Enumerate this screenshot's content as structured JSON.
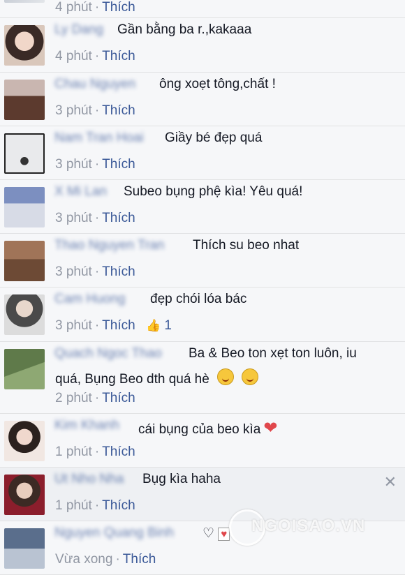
{
  "comments": [
    {
      "name": "",
      "text": "",
      "time": "4 phút",
      "like": "Thích",
      "likes": ""
    },
    {
      "name": "Ly Dang",
      "text": "Gần bằng ba r.,kakaaa",
      "time": "4 phút",
      "like": "Thích",
      "likes": ""
    },
    {
      "name": "Chau Nguyen",
      "text": "ông xoẹt tông,chất !",
      "time": "3 phút",
      "like": "Thích",
      "likes": ""
    },
    {
      "name": "Nam Tran Hoai",
      "text": "Giầy bé đẹp quá",
      "time": "3 phút",
      "like": "Thích",
      "likes": ""
    },
    {
      "name": "X Mi Lan",
      "text": "Subeo bụng phệ kìa! Yêu quá!",
      "time": "3 phút",
      "like": "Thích",
      "likes": ""
    },
    {
      "name": "Thao Nguyen Tran",
      "text": "Thích su beo nhat",
      "time": "3 phút",
      "like": "Thích",
      "likes": ""
    },
    {
      "name": "Cam Huong",
      "text": "đẹp chói lóa bác",
      "time": "3 phút",
      "like": "Thích",
      "likes": "1"
    },
    {
      "name": "Quach Ngoc Thao",
      "text": "Ba & Beo ton xẹt ton luôn, iu",
      "text2": "quá, Bụng Beo dth quá hè",
      "time": "2 phút",
      "like": "Thích",
      "likes": ""
    },
    {
      "name": "Kim Khanh",
      "text": "cái bụng của beo kìa",
      "time": "1 phút",
      "like": "Thích",
      "likes": ""
    },
    {
      "name": "Ut Nho Nha",
      "text": "Bụg kìa haha",
      "time": "1 phút",
      "like": "Thích",
      "likes": ""
    },
    {
      "name": "Nguyen Quang Binh",
      "text": "♡",
      "time": "Vừa xong",
      "like": "Thích",
      "likes": ""
    }
  ],
  "icons": {
    "thumb": "thumbs-up-icon",
    "close": "close-icon",
    "heart": "heart-icon",
    "smiley": "kiss-emoji-icon"
  },
  "colors": {
    "link": "#3b5998",
    "meta": "#9197a3",
    "heart": "#e0474c"
  },
  "watermark": "NGOISAO.VN"
}
